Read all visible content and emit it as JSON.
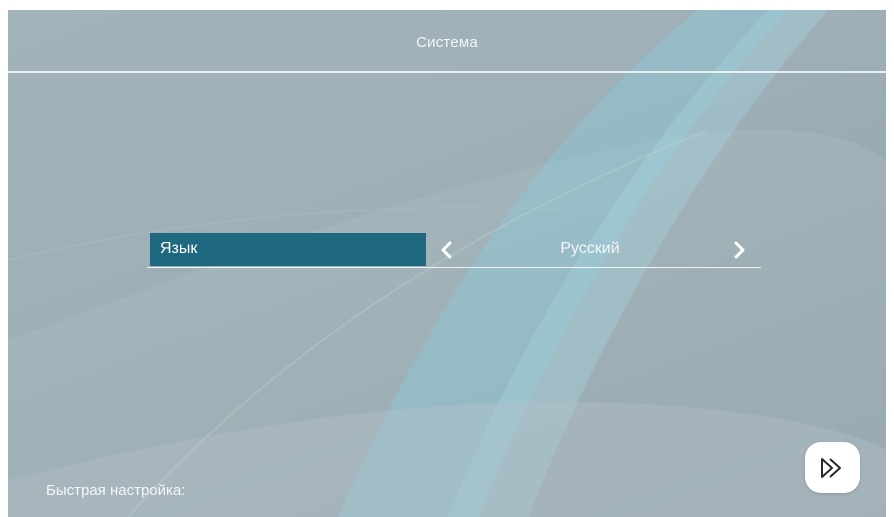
{
  "header": {
    "title": "Система"
  },
  "setting": {
    "label": "Язык",
    "value": "Русский",
    "prev_icon": "chevron-left-icon",
    "next_icon": "chevron-right-icon"
  },
  "footer": {
    "quick_setup_label": "Быстрая настройка:",
    "next_icon": "double-play-forward-icon"
  },
  "colors": {
    "background": "#a0b1b9",
    "selected_label": "#1e6880",
    "text": "#f3f6f8",
    "button": "#ffffff"
  }
}
